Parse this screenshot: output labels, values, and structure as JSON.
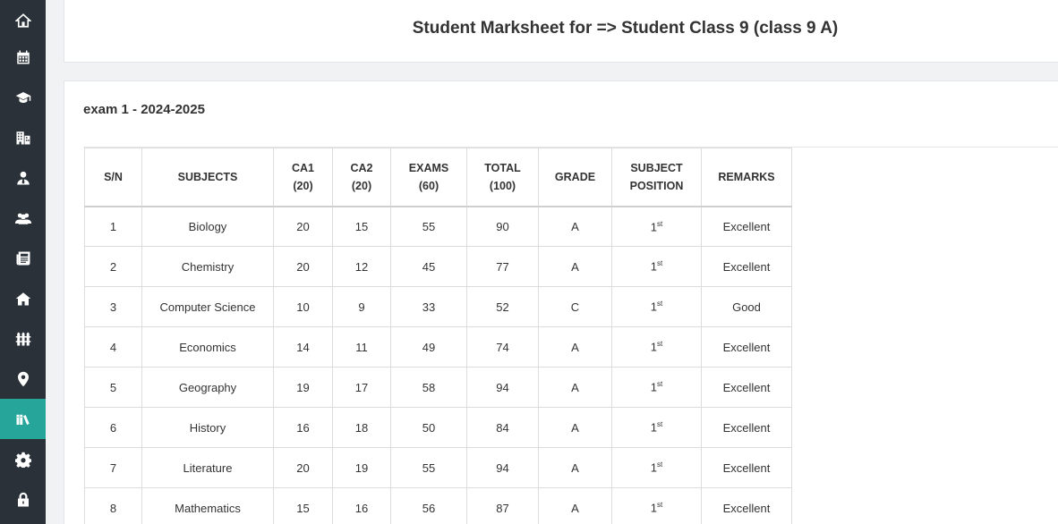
{
  "sidebar": {
    "items": [
      {
        "icon": "home-icon",
        "active": false
      },
      {
        "icon": "calendar-icon",
        "active": false
      },
      {
        "icon": "graduation-cap-icon",
        "active": false
      },
      {
        "icon": "building-icon",
        "active": false
      },
      {
        "icon": "user-tie-icon",
        "active": false
      },
      {
        "icon": "users-icon",
        "active": false
      },
      {
        "icon": "newspaper-icon",
        "active": false
      },
      {
        "icon": "house-icon",
        "active": false
      },
      {
        "icon": "fence-icon",
        "active": false
      },
      {
        "icon": "map-marker-icon",
        "active": false
      },
      {
        "icon": "books-icon",
        "active": true
      },
      {
        "icon": "gear-icon",
        "active": false
      },
      {
        "icon": "lock-icon",
        "active": false
      }
    ],
    "active_color": "#26a69a",
    "background_color": "#2a3138"
  },
  "header": {
    "title": "Student Marksheet for => Student Class 9 (class 9 A)"
  },
  "exam": {
    "title": "exam 1 - 2024-2025"
  },
  "table": {
    "columns": [
      {
        "line1": "S/N",
        "line2": ""
      },
      {
        "line1": "SUBJECTS",
        "line2": ""
      },
      {
        "line1": "CA1",
        "line2": "(20)"
      },
      {
        "line1": "CA2",
        "line2": "(20)"
      },
      {
        "line1": "EXAMS",
        "line2": "(60)"
      },
      {
        "line1": "TOTAL",
        "line2": "(100)"
      },
      {
        "line1": "GRADE",
        "line2": ""
      },
      {
        "line1": "SUBJECT",
        "line2": "POSITION"
      },
      {
        "line1": "REMARKS",
        "line2": ""
      }
    ],
    "rows": [
      {
        "sn": "1",
        "subject": "Biology",
        "ca1": "20",
        "ca2": "15",
        "exams": "55",
        "total": "90",
        "grade": "A",
        "position": "1",
        "position_suffix": "st",
        "remarks": "Excellent"
      },
      {
        "sn": "2",
        "subject": "Chemistry",
        "ca1": "20",
        "ca2": "12",
        "exams": "45",
        "total": "77",
        "grade": "A",
        "position": "1",
        "position_suffix": "st",
        "remarks": "Excellent"
      },
      {
        "sn": "3",
        "subject": "Computer Science",
        "ca1": "10",
        "ca2": "9",
        "exams": "33",
        "total": "52",
        "grade": "C",
        "position": "1",
        "position_suffix": "st",
        "remarks": "Good"
      },
      {
        "sn": "4",
        "subject": "Economics",
        "ca1": "14",
        "ca2": "11",
        "exams": "49",
        "total": "74",
        "grade": "A",
        "position": "1",
        "position_suffix": "st",
        "remarks": "Excellent"
      },
      {
        "sn": "5",
        "subject": "Geography",
        "ca1": "19",
        "ca2": "17",
        "exams": "58",
        "total": "94",
        "grade": "A",
        "position": "1",
        "position_suffix": "st",
        "remarks": "Excellent"
      },
      {
        "sn": "6",
        "subject": "History",
        "ca1": "16",
        "ca2": "18",
        "exams": "50",
        "total": "84",
        "grade": "A",
        "position": "1",
        "position_suffix": "st",
        "remarks": "Excellent"
      },
      {
        "sn": "7",
        "subject": "Literature",
        "ca1": "20",
        "ca2": "19",
        "exams": "55",
        "total": "94",
        "grade": "A",
        "position": "1",
        "position_suffix": "st",
        "remarks": "Excellent"
      },
      {
        "sn": "8",
        "subject": "Mathematics",
        "ca1": "15",
        "ca2": "16",
        "exams": "56",
        "total": "87",
        "grade": "A",
        "position": "1",
        "position_suffix": "st",
        "remarks": "Excellent"
      }
    ]
  }
}
